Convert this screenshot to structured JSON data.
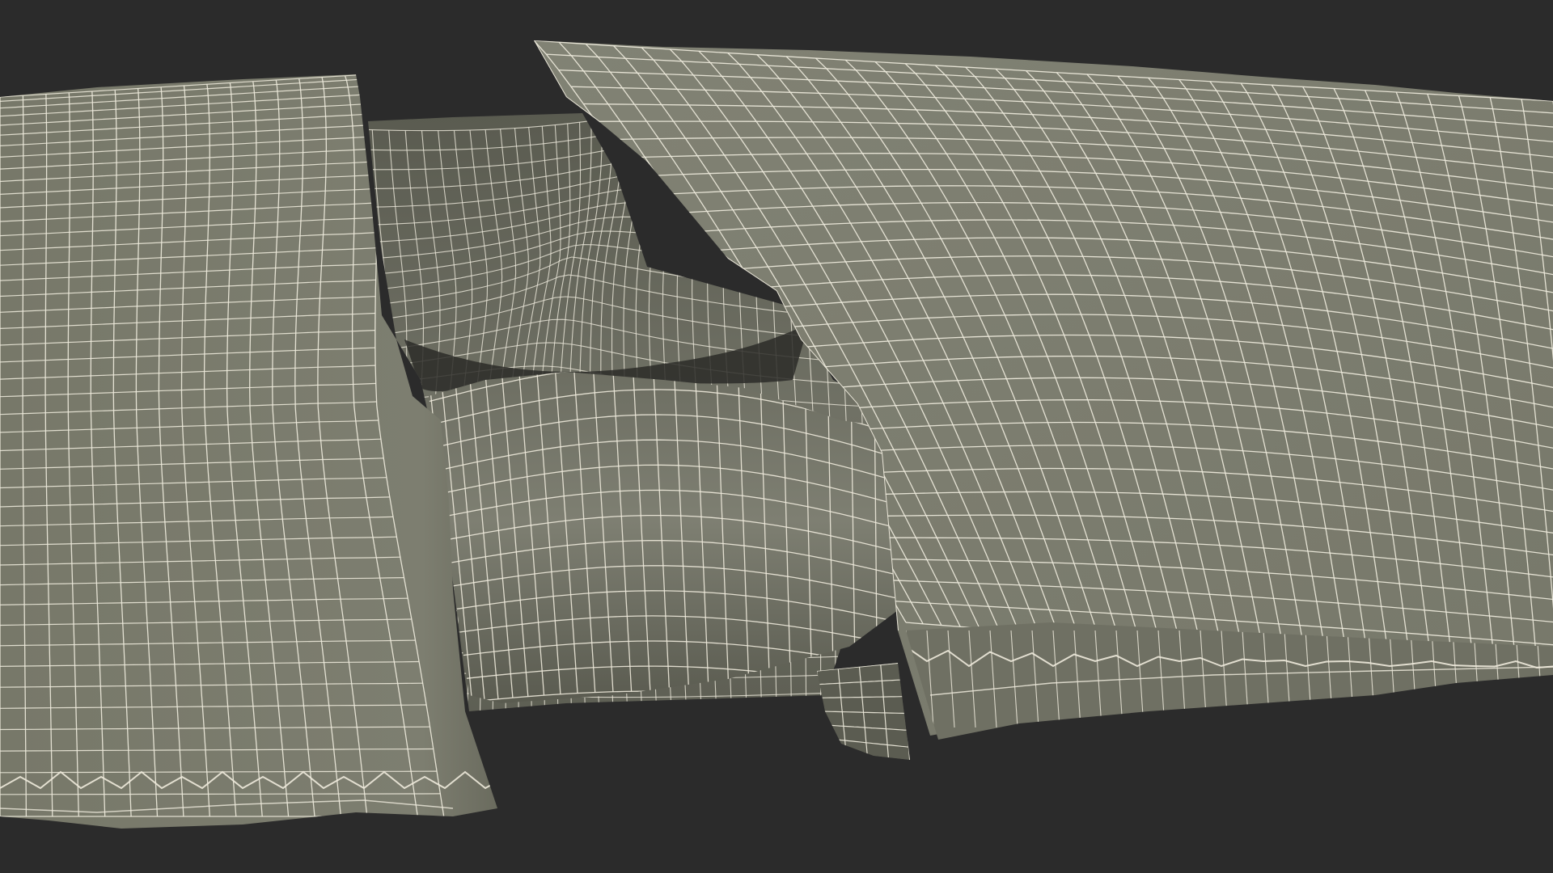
{
  "scene": {
    "subject": "wireframe-render-torn-wrapper",
    "background_color": "#2b2b2b",
    "surface_color": "#7b7c6e",
    "surface_shadow_color": "#5c5d52",
    "inner_surface_color": "#6e6f63",
    "wire_color": "#eeeadc"
  }
}
